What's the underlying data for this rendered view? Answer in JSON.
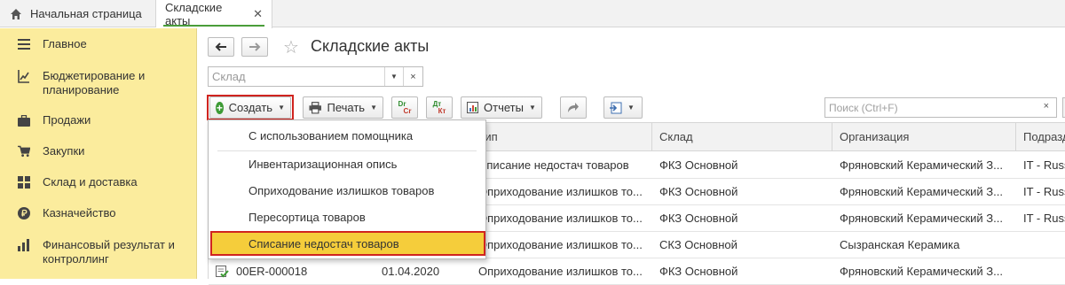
{
  "tabs": {
    "home_label": "Начальная страница",
    "active_label": "Складские акты",
    "close_glyph": "✕"
  },
  "sidebar": {
    "items": [
      {
        "label": "Главное",
        "icon": "menu-icon"
      },
      {
        "label": "Бюджетирование и планирование",
        "icon": "budget-chart-icon"
      },
      {
        "label": "Продажи",
        "icon": "briefcase-icon"
      },
      {
        "label": "Закупки",
        "icon": "cart-icon"
      },
      {
        "label": "Склад и доставка",
        "icon": "warehouse-grid-icon"
      },
      {
        "label": "Казначейство",
        "icon": "ruble-coin-icon"
      },
      {
        "label": "Финансовый результат и контроллинг",
        "icon": "bar-chart-icon"
      }
    ],
    "bg_color": "#fbec9d"
  },
  "header": {
    "back_glyph": "🡐",
    "forward_glyph": "🡒",
    "star_glyph": "☆",
    "title": "Складские акты"
  },
  "filter": {
    "warehouse_placeholder": "Склад",
    "clear_glyph": "×"
  },
  "toolbar": {
    "create_label": "Создать",
    "print_label": "Печать",
    "dt_cr_top": "Dr",
    "dt_cr_bottom": "Cr",
    "dt_kt_top": "Дт",
    "dt_kt_bottom": "Кт",
    "reports_label": "Отчеты",
    "search_placeholder": "Поиск (Ctrl+F)",
    "search_clear": "×"
  },
  "table": {
    "columns": [
      "",
      "",
      "Тип",
      "Склад",
      "Организация",
      "Подразделение"
    ],
    "rows": [
      {
        "number": "",
        "date": "",
        "type": "Списание недостач товаров",
        "warehouse": "ФКЗ Основной",
        "org": "Фряновский Керамический З...",
        "dept": "IT - Russ"
      },
      {
        "number": "",
        "date": "",
        "type": "Оприходование излишков то...",
        "warehouse": "ФКЗ Основной",
        "org": "Фряновский Керамический З...",
        "dept": "IT - Russ"
      },
      {
        "number": "",
        "date": "",
        "type": "Оприходование излишков то...",
        "warehouse": "ФКЗ Основной",
        "org": "Фряновский Керамический З...",
        "dept": "IT - Russ"
      },
      {
        "number": "",
        "date": "",
        "type": "Оприходование излишков то...",
        "warehouse": "СКЗ Основной",
        "org": "Сызранская Керамика",
        "dept": ""
      },
      {
        "number": "00ER-000018",
        "date": "01.04.2020",
        "type": "Оприходование излишков то...",
        "warehouse": "ФКЗ Основной",
        "org": "Фряновский Керамический З...",
        "dept": ""
      }
    ]
  },
  "create_menu": {
    "items": [
      "С использованием помощника",
      "Инвентаризационная опись",
      "Оприходование излишков товаров",
      "Пересортица товаров",
      "Списание недостач товаров"
    ],
    "highlight_color": "#f5cd3b",
    "border_color": "#d0241f"
  }
}
